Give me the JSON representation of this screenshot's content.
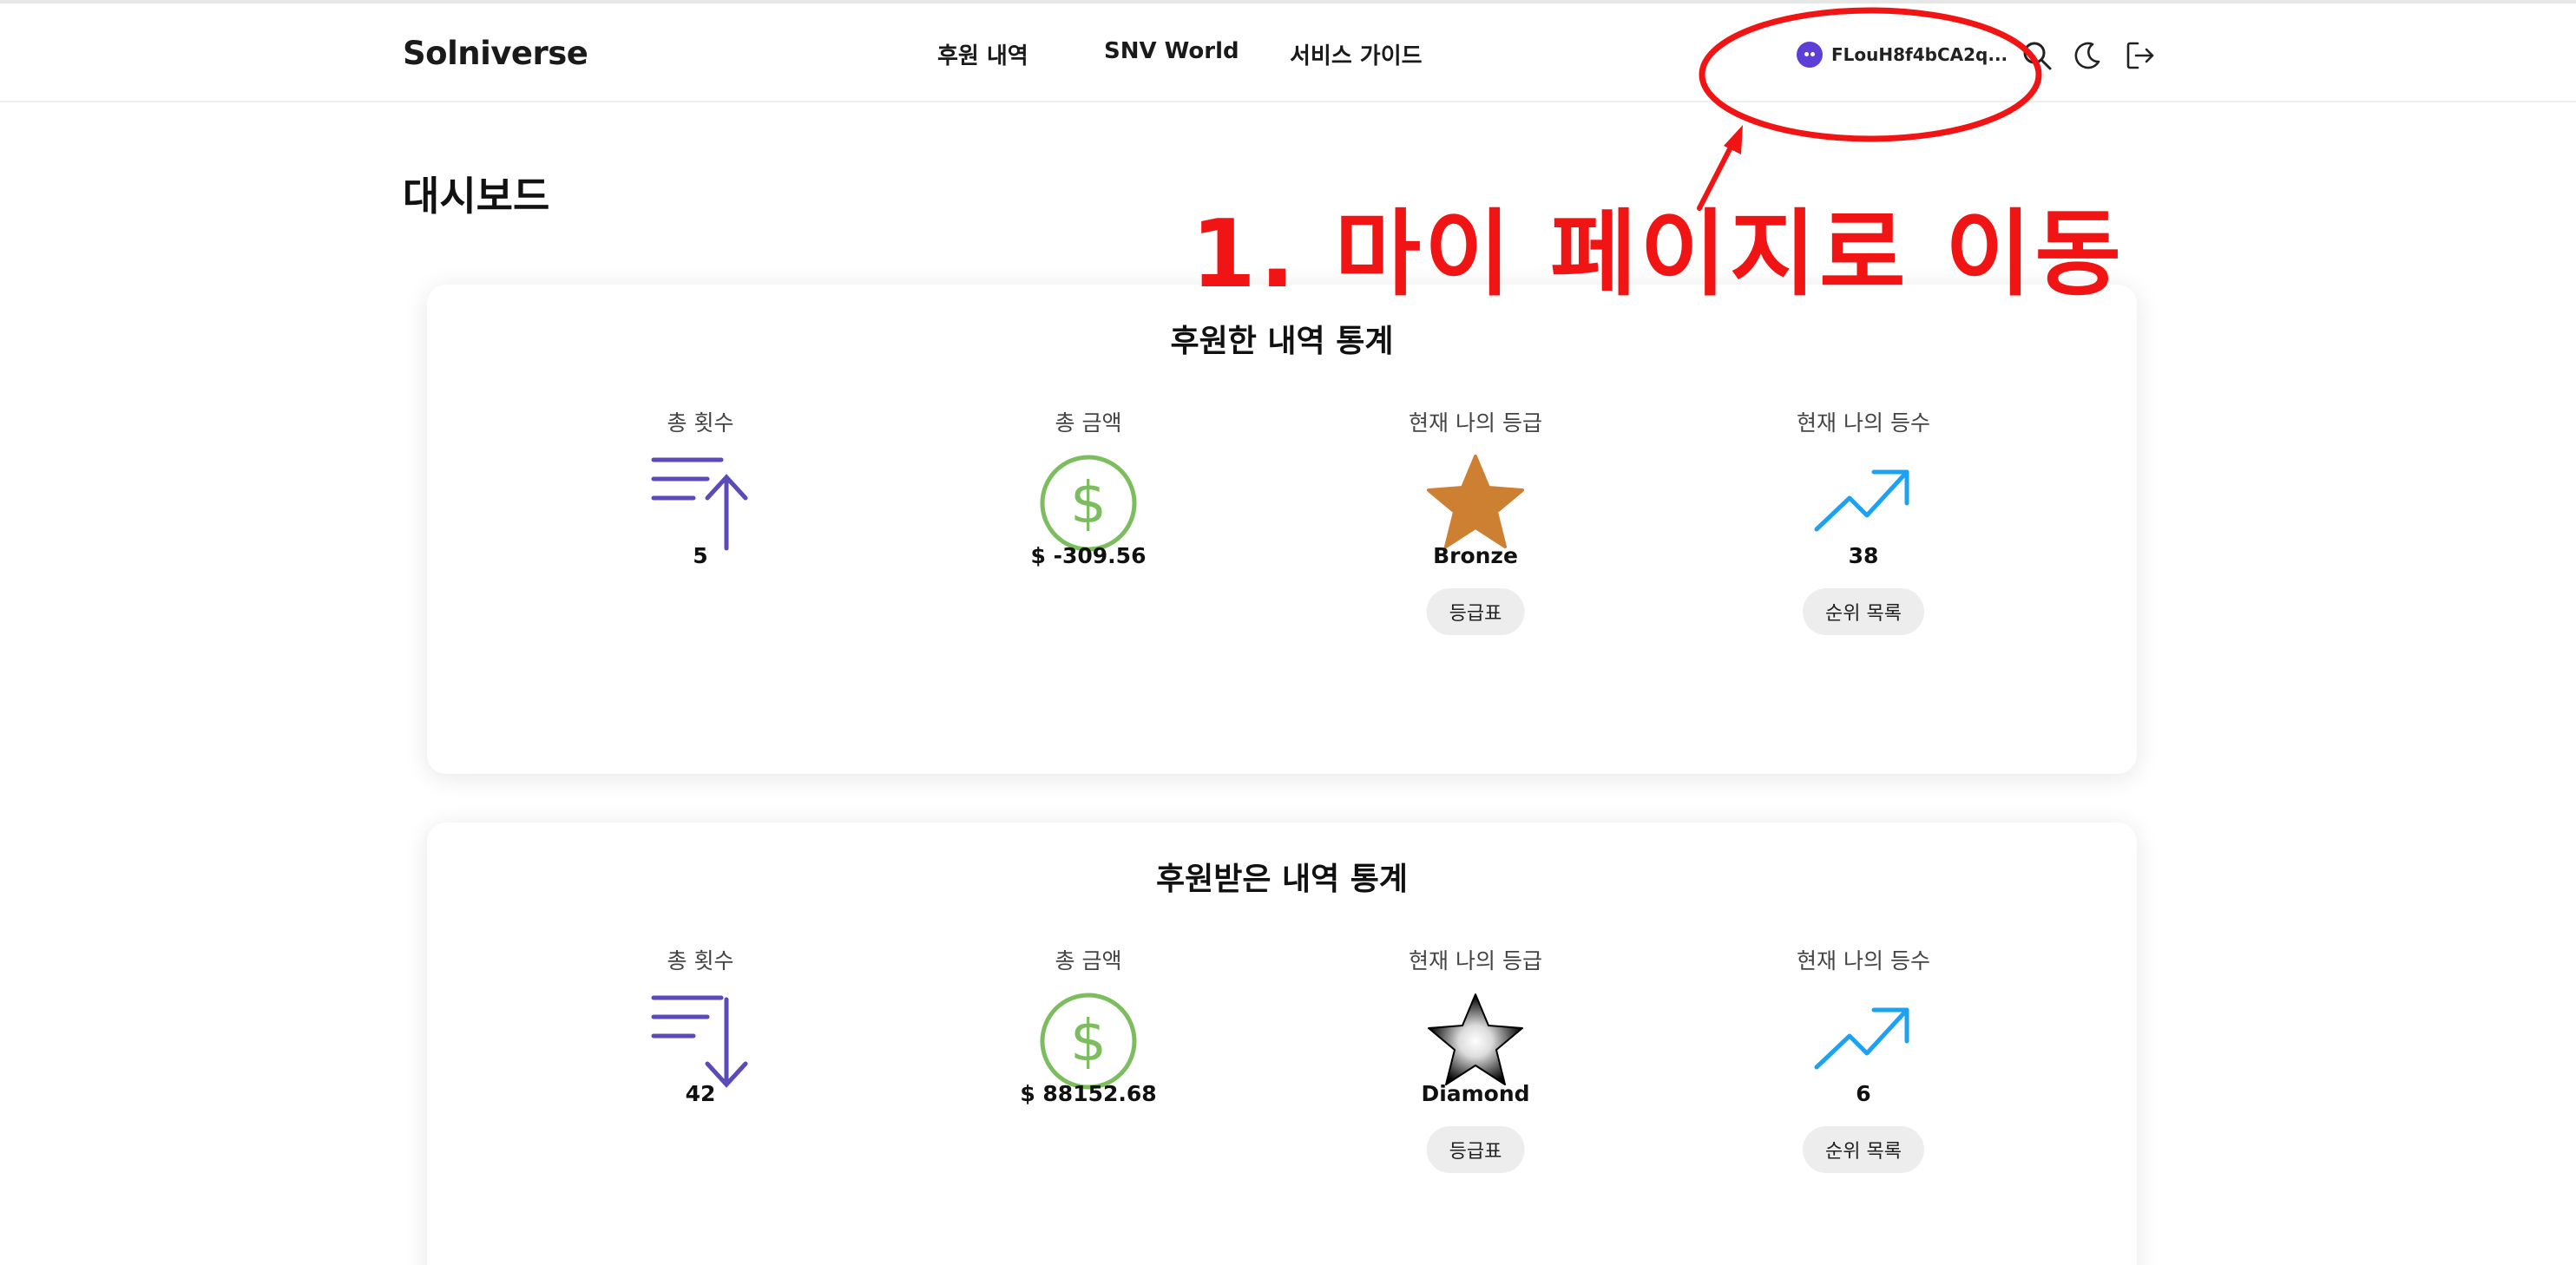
{
  "header": {
    "logo": "Solniverse",
    "nav": [
      "후원 내역",
      "SNV World",
      "서비스 가이드"
    ],
    "wallet_address": "FLouH8f4bCA2q...",
    "icons": [
      "search-icon",
      "moon-icon",
      "logout-icon"
    ]
  },
  "page_title": "대시보드",
  "sponsored_stats": {
    "title": "후원한 내역 통계",
    "items": [
      {
        "label": "총 횟수",
        "value": "5",
        "icon": "sort-ascending-icon"
      },
      {
        "label": "총 금액",
        "value": "$ -309.56",
        "icon": "dollar-icon"
      },
      {
        "label": "현재 나의 등급",
        "value": "Bronze",
        "icon": "bronze-star-icon",
        "button": "등급표"
      },
      {
        "label": "현재 나의 등수",
        "value": "38",
        "icon": "trending-up-icon",
        "button": "순위 목록"
      }
    ]
  },
  "received_stats": {
    "title": "후원받은 내역 통계",
    "items": [
      {
        "label": "총 횟수",
        "value": "42",
        "icon": "sort-descending-icon"
      },
      {
        "label": "총 금액",
        "value": "$ 88152.68",
        "icon": "dollar-icon"
      },
      {
        "label": "현재 나의 등급",
        "value": "Diamond",
        "icon": "diamond-star-icon",
        "button": "등급표"
      },
      {
        "label": "현재 나의 등수",
        "value": "6",
        "icon": "trending-up-icon",
        "button": "순위 목록"
      }
    ]
  },
  "annotation": {
    "text": "1. 마이 페이지로 이동",
    "color": "#f01414"
  },
  "colors": {
    "accent_purple": "#5a4bb8",
    "dollar_green": "#7cbd5e",
    "bronze": "#cd7f32",
    "trend_blue": "#1da1f2"
  }
}
